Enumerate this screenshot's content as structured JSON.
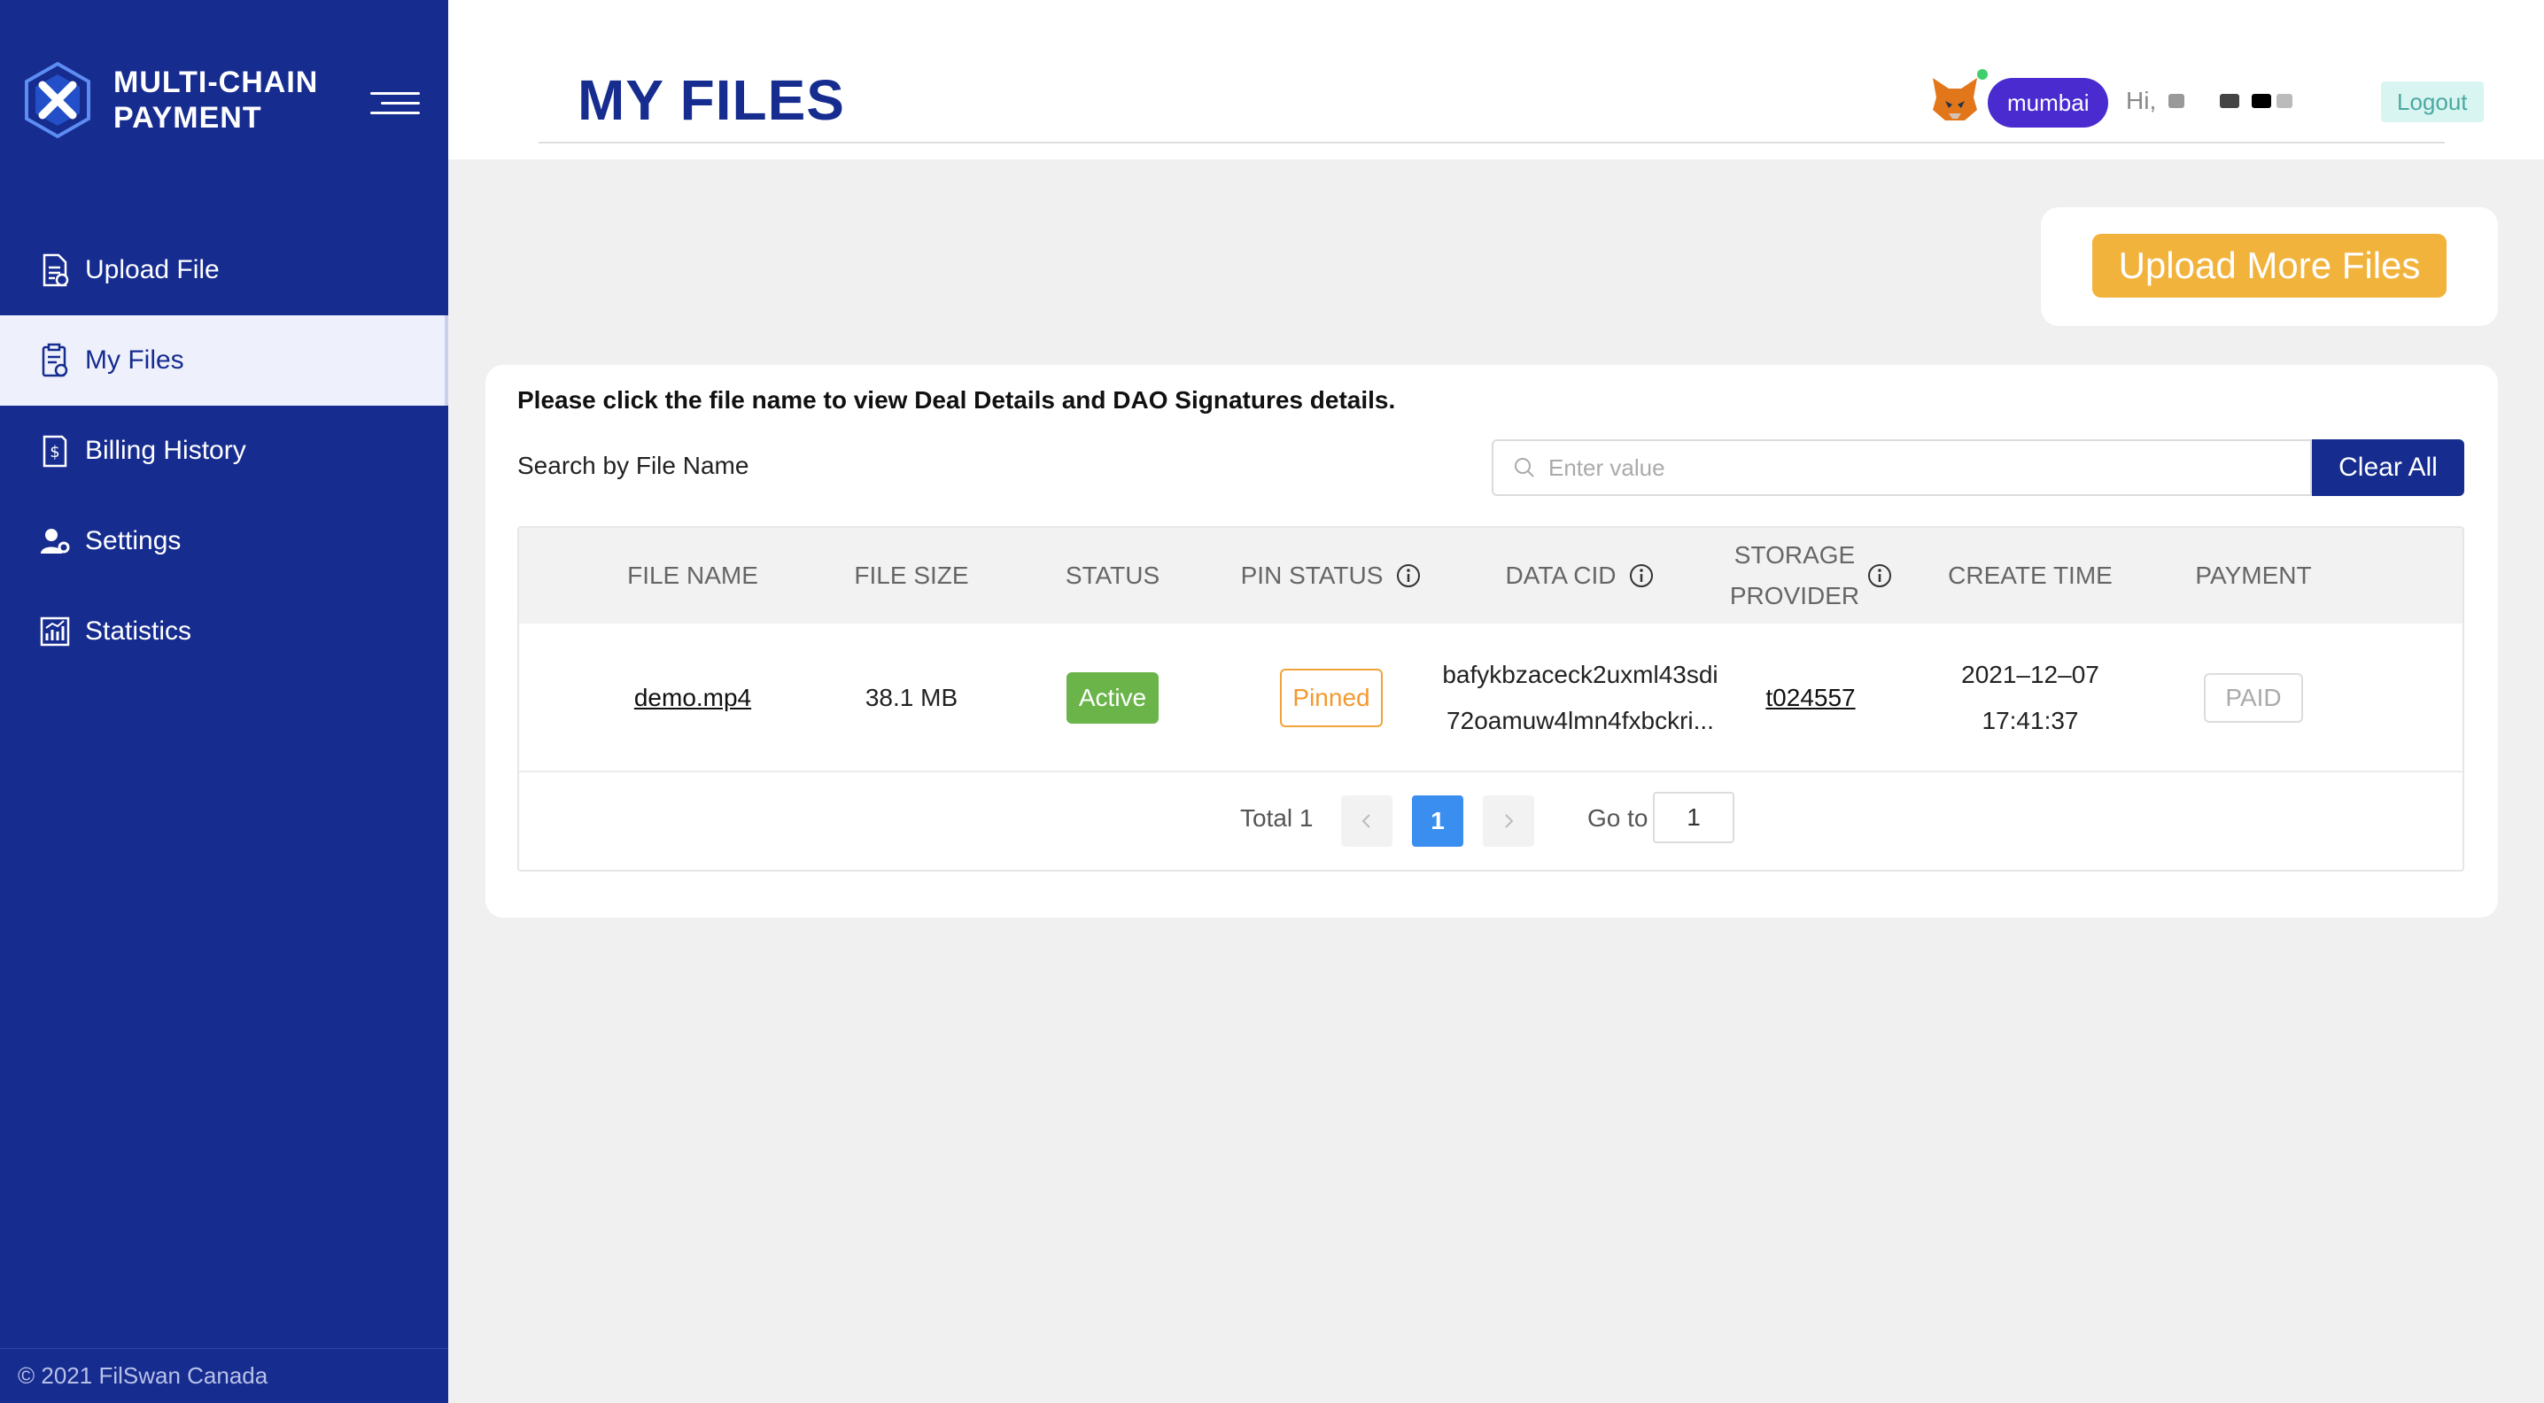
{
  "app": {
    "logo_line1": "MULTI-CHAIN",
    "logo_line2": "PAYMENT",
    "footer": "© 2021 FilSwan Canada"
  },
  "sidebar": {
    "items": [
      {
        "label": "Upload File",
        "icon": "upload-file-icon"
      },
      {
        "label": "My Files",
        "icon": "my-files-icon",
        "active": true
      },
      {
        "label": "Billing History",
        "icon": "billing-icon"
      },
      {
        "label": "Settings",
        "icon": "settings-icon"
      },
      {
        "label": "Statistics",
        "icon": "statistics-icon"
      }
    ]
  },
  "header": {
    "title": "MY FILES",
    "network": "mumbai",
    "greeting": "Hi,",
    "logout": "Logout"
  },
  "actions": {
    "upload_more": "Upload More Files"
  },
  "main": {
    "hint": "Please click the file name to view Deal Details and DAO Signatures details.",
    "search_label": "Search by File Name",
    "search_placeholder": "Enter value",
    "clear_all": "Clear All"
  },
  "table": {
    "columns": [
      "FILE NAME",
      "FILE SIZE",
      "STATUS",
      "PIN STATUS",
      "DATA CID",
      "STORAGE PROVIDER",
      "CREATE TIME",
      "PAYMENT"
    ],
    "rows": [
      {
        "file_name": "demo.mp4",
        "file_size": "38.1 MB",
        "status": "Active",
        "pin_status": "Pinned",
        "data_cid_line1": "bafykbzaceck2uxml43sdi",
        "data_cid_line2": "72oamuw4lmn4fxbckri...",
        "storage_provider": "t024557",
        "create_date": "2021–12–07",
        "create_time": "17:41:37",
        "payment": "PAID"
      }
    ]
  },
  "pagination": {
    "total": "Total 1",
    "current_page": "1",
    "goto_label": "Go to",
    "goto_value": "1"
  },
  "colors": {
    "sidebar": "#162c8f",
    "accent_orange": "#f2b33c",
    "active_green": "#6ab44a",
    "page_blue": "#3a8ef0",
    "network_purple": "#4a2bd0"
  }
}
